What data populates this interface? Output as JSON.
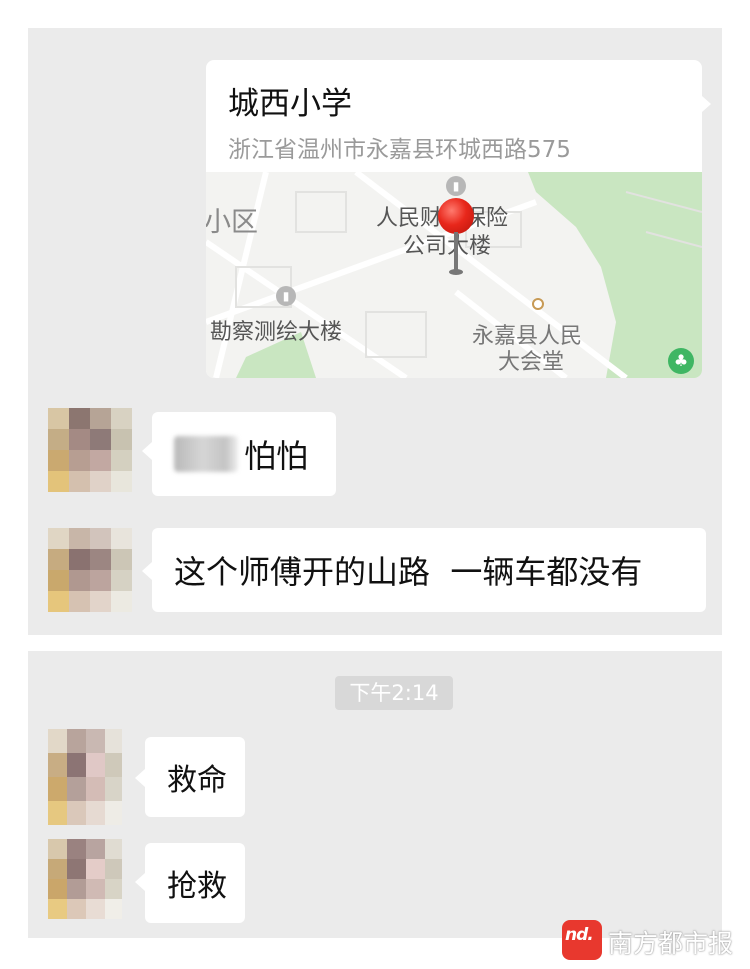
{
  "location_message": {
    "title": "城西小学",
    "address": "浙江省温州市永嘉县环城西路575",
    "map": {
      "labels": [
        "小区",
        "人民财产保险",
        "公司大楼",
        "勘察测绘大楼",
        "永嘉县人民",
        "大会堂"
      ]
    }
  },
  "messages": [
    {
      "id": "m1",
      "text": "怕怕"
    },
    {
      "id": "m2",
      "text": "这个师傅开的山路  一辆车都没有"
    }
  ],
  "timestamp": "下午2:14",
  "messages_after": [
    {
      "id": "m3",
      "text": "救命"
    },
    {
      "id": "m4",
      "text": "抢救"
    }
  ],
  "watermark": {
    "logo": "nd.",
    "text": "南方都市报"
  },
  "colors": {
    "chat_bg": "#ebebeb",
    "bubble": "#ffffff",
    "pin": "#e8271b",
    "map_green": "#c9e6c1",
    "watermark_red": "#e8382e"
  }
}
